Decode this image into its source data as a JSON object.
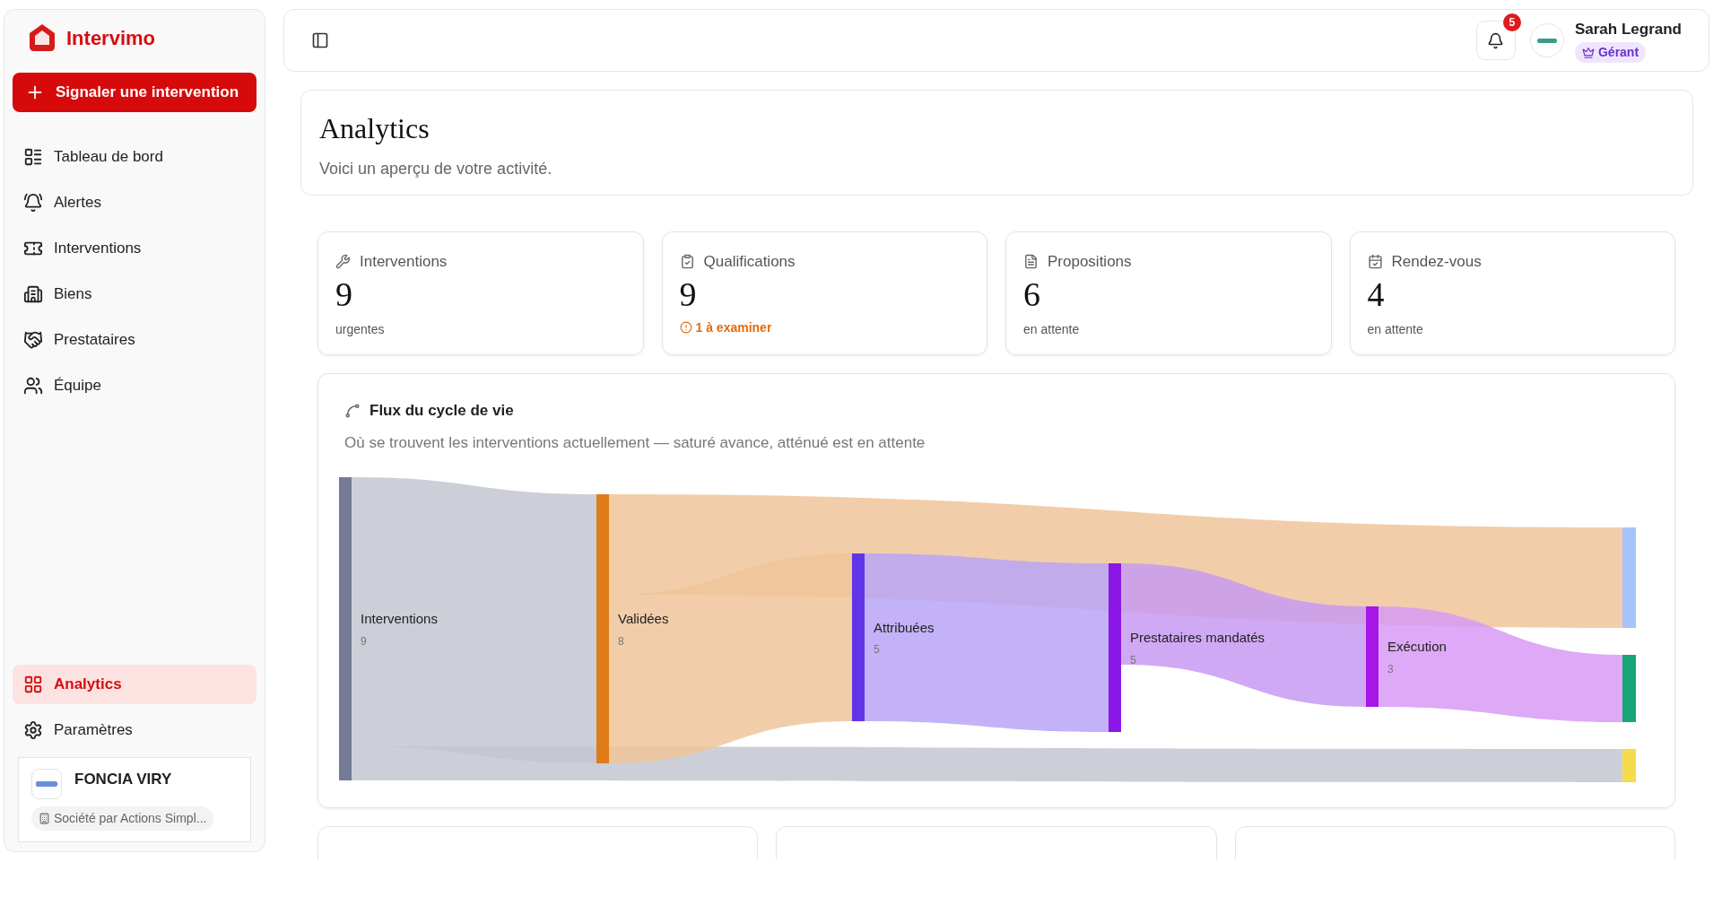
{
  "brand": {
    "name": "Intervimo"
  },
  "report_button": {
    "label": "Signaler une intervention"
  },
  "nav": [
    {
      "label": "Tableau de bord",
      "selected": false
    },
    {
      "label": "Alertes",
      "selected": false
    },
    {
      "label": "Interventions",
      "selected": false
    },
    {
      "label": "Biens",
      "selected": false
    },
    {
      "label": "Prestataires",
      "selected": false
    },
    {
      "label": "Équipe",
      "selected": false
    }
  ],
  "bottom_nav": [
    {
      "label": "Analytics",
      "selected": true
    },
    {
      "label": "Paramètres",
      "selected": false
    }
  ],
  "organization": {
    "name": "FONCIA VIRY",
    "legal_form": "Société par Actions Simpl..."
  },
  "topbar": {
    "notifications": "5",
    "user": {
      "name": "Sarah Legrand",
      "role": "Gérant"
    }
  },
  "page": {
    "title": "Analytics",
    "subtitle": "Voici un aperçu de votre activité."
  },
  "stats": [
    {
      "label": "Interventions",
      "value": "9",
      "note": "urgentes",
      "kind": "plain"
    },
    {
      "label": "Qualifications",
      "value": "9",
      "note": "1 à examiner",
      "kind": "warning"
    },
    {
      "label": "Propositions",
      "value": "6",
      "note": "en attente",
      "kind": "plain"
    },
    {
      "label": "Rendez-vous",
      "value": "4",
      "note": "en attente",
      "kind": "plain"
    }
  ],
  "lifecycle": {
    "title": "Flux du cycle de vie",
    "subtitle": "Où se trouvent les interventions actuellement — saturé avance, atténué est en attente",
    "nodes": [
      {
        "label": "Interventions",
        "count": "9",
        "color": "#737b96"
      },
      {
        "label": "Validées",
        "count": "8",
        "color": "#e07b1a"
      },
      {
        "label": "Attribuées",
        "count": "5",
        "color": "#6234e8"
      },
      {
        "label": "Prestataires mandatés",
        "count": "5",
        "color": "#8a17e6"
      },
      {
        "label": "Exécution",
        "count": "3",
        "color": "#a716e8"
      }
    ],
    "end_nodes": [
      {
        "color": "#a5c4fb"
      },
      {
        "color": "#17a578"
      },
      {
        "color": "#f5dc4a"
      }
    ]
  }
}
